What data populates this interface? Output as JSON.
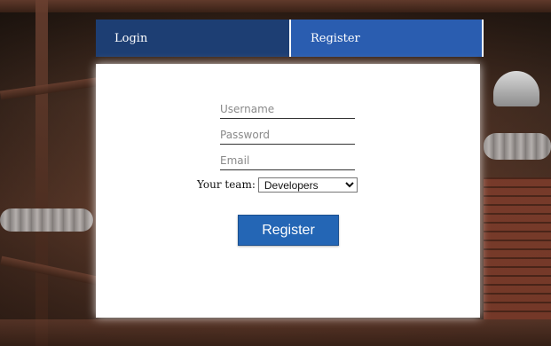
{
  "tabs": {
    "login_label": "Login",
    "register_label": "Register",
    "active": "Register"
  },
  "form": {
    "username": {
      "placeholder": "Username",
      "value": ""
    },
    "password": {
      "placeholder": "Password",
      "value": ""
    },
    "email": {
      "placeholder": "Email",
      "value": ""
    },
    "team": {
      "label": "Your team:",
      "selected": "Developers",
      "options": [
        "Developers"
      ]
    },
    "submit_label": "Register"
  },
  "colors": {
    "login_tab": "#1d3e73",
    "register_tab": "#2a5db0",
    "button": "#2466b5",
    "panel": "#ffffff"
  }
}
